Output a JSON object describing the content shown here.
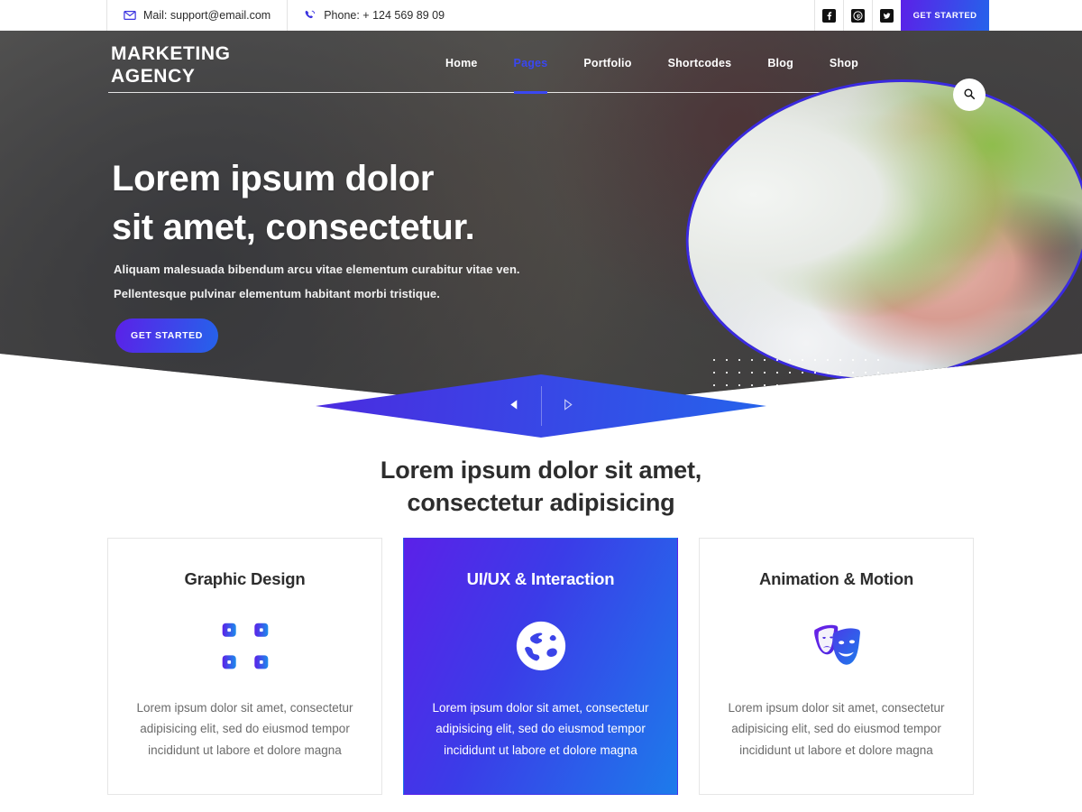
{
  "topbar": {
    "mail": "Mail: support@email.com",
    "phone": "Phone: + 124 569 89 09",
    "mail_icon": "envelope-icon",
    "phone_icon": "phone-icon",
    "socials": [
      {
        "name": "facebook-icon",
        "glyph": "f"
      },
      {
        "name": "pinterest-icon",
        "glyph": "P"
      },
      {
        "name": "twitter-icon",
        "glyph": "t"
      }
    ],
    "cta_label": "GET STARTED"
  },
  "header": {
    "logo_line1": "MARKETING",
    "logo_line2": "AGENCY",
    "nav": [
      {
        "label": "Home",
        "active": false
      },
      {
        "label": "Pages",
        "active": true
      },
      {
        "label": "Portfolio",
        "active": false
      },
      {
        "label": "Shortcodes",
        "active": false
      },
      {
        "label": "Blog",
        "active": false
      },
      {
        "label": "Shop",
        "active": false
      }
    ],
    "search_icon": "search-icon"
  },
  "hero": {
    "title_line1": "Lorem ipsum dolor",
    "title_line2": "sit amet, consectetur.",
    "sub_line1": "Aliquam malesuada bibendum arcu vitae elementum curabitur vitae ven.",
    "sub_line2": "Pellentesque pulvinar elementum habitant morbi tristique.",
    "cta_label": "GET STARTED",
    "image_alt": "businesswoman-on-phone-with-laptop"
  },
  "slider": {
    "prev_icon": "triangle-left-icon",
    "next_icon": "triangle-right-icon"
  },
  "section": {
    "heading_line1": "Lorem ipsum dolor sit amet,",
    "heading_line2": "consectetur adipisicing"
  },
  "cards": [
    {
      "title": "Graphic Design",
      "icon": "crop-frame-icon",
      "text": "Lorem ipsum dolor sit amet, consectetur adipisicing elit, sed do eiusmod tempor incididunt ut labore et dolore magna",
      "featured": false
    },
    {
      "title": "UI/UX & Interaction",
      "icon": "globe-icon",
      "text": "Lorem ipsum dolor sit amet, consectetur adipisicing elit, sed do eiusmod tempor incididunt ut labore et dolore magna",
      "featured": true
    },
    {
      "title": "Animation & Motion",
      "icon": "theater-masks-icon",
      "text": "Lorem ipsum dolor sit amet, consectetur adipisicing elit, sed do eiusmod tempor incididunt ut labore et dolore magna",
      "featured": false
    }
  ],
  "colors": {
    "accent_purple": "#5B21E8",
    "accent_blue": "#2563EB",
    "nav_active": "#3A47F2",
    "ellipse_border": "#3A2AE0",
    "text_dark": "#2D2D2D",
    "text_body": "#6B6B6B"
  }
}
